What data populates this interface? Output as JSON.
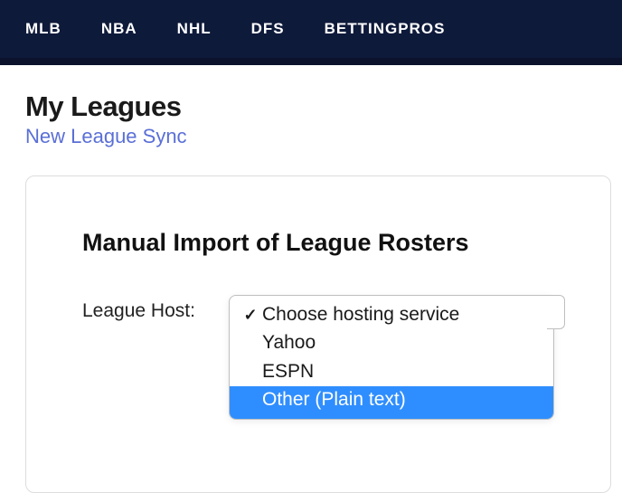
{
  "nav": {
    "items": [
      "MLB",
      "NBA",
      "NHL",
      "DFS",
      "BETTINGPROS"
    ]
  },
  "header": {
    "title": "My Leagues",
    "subtitle": "New League Sync"
  },
  "card": {
    "heading": "Manual Import of League Rosters",
    "form": {
      "host_label": "League Host:"
    }
  },
  "dropdown": {
    "selected_index": 0,
    "highlight_index": 3,
    "options": [
      "Choose hosting service",
      "Yahoo",
      "ESPN",
      "Other (Plain text)"
    ]
  }
}
